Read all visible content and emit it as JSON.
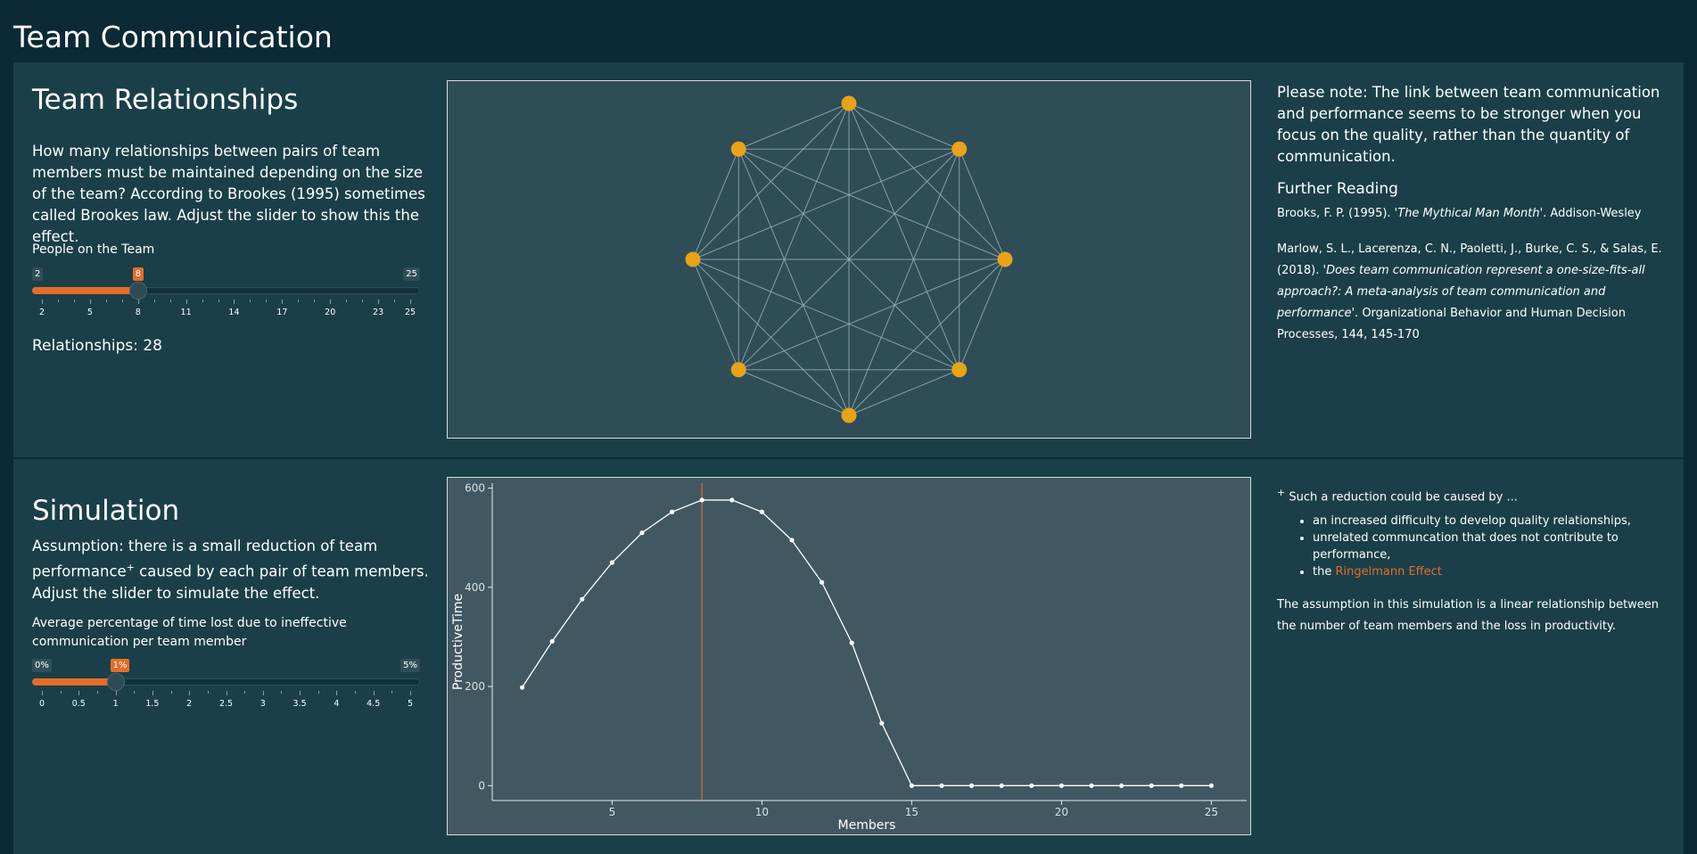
{
  "app_title": "Team Communication",
  "relationships": {
    "title": "Team Relationships",
    "description": "How many relationships between pairs of team members must be maintained depending on the size of the team? According to Brookes (1995) sometimes called Brookes law. Adjust the slider to show this the effect.",
    "slider": {
      "label": "People on the Team",
      "min": 2,
      "max": 25,
      "value": 8,
      "min_label": "2",
      "max_label": "25",
      "value_label": "8",
      "ticks": [
        "2",
        "5",
        "8",
        "11",
        "14",
        "17",
        "20",
        "23",
        "25"
      ],
      "tick_values": [
        2,
        5,
        8,
        11,
        14,
        17,
        20,
        23,
        25
      ]
    },
    "result_text": "Relationships: 28",
    "network": {
      "nodes": 8,
      "node_color": "#e8a317",
      "edge_color": "#a9b8bc"
    }
  },
  "notes": {
    "note": "Please note: The link between team communication and performance seems to be stronger when you focus on the quality, rather than the quantity of communication.",
    "further_reading": "Further Reading",
    "ref1_pre": "Brooks, F. P. (1995). '",
    "ref1_title": "The Mythical Man Month",
    "ref1_post": "'. Addison-Wesley",
    "ref2_pre": "Marlow, S. L., Lacerenza, C. N., Paoletti, J., Burke, C. S., & Salas, E. (2018). '",
    "ref2_title": "Does team communication represent a one-size-fits-all approach?: A meta-analysis of team communication and performance",
    "ref2_post": "'. Organizational Behavior and Human Decision Processes, 144, 145-170"
  },
  "simulation": {
    "title": "Simulation",
    "description_pre": "Assumption: there is a small reduction of team performance",
    "description_mark": "+",
    "description_post": " caused by each pair of team members. Adjust the slider to simulate the effect.",
    "slider": {
      "label": "Average percentage of time lost due to ineffective communication per team member",
      "min": 0,
      "max": 5,
      "value": 1,
      "min_label": "0%",
      "max_label": "5%",
      "value_label": "1%",
      "ticks": [
        "0",
        "0.5",
        "1",
        "1.5",
        "2",
        "2.5",
        "3",
        "3.5",
        "4",
        "4.5",
        "5"
      ],
      "tick_values": [
        0,
        0.5,
        1,
        1.5,
        2,
        2.5,
        3,
        3.5,
        4,
        4.5,
        5
      ]
    }
  },
  "footnote": {
    "mark": "+",
    "intro": "Such a reduction could be caused by ...",
    "items": [
      "an increased difficulty to develop quality relationships,",
      "unrelated communcation that does not contribute to performance,"
    ],
    "item3_pre": "the ",
    "item3_link": "Ringelmann Effect",
    "conclusion": "The assumption in this simulation is a linear relationship between the number of team members and the loss in productivity."
  },
  "chart_data": {
    "type": "line",
    "xlabel": "Members",
    "ylabel": "ProductiveTime",
    "xlim": [
      1,
      26
    ],
    "ylim": [
      -30,
      610
    ],
    "xticks": [
      5,
      10,
      15,
      20,
      25
    ],
    "yticks": [
      0,
      200,
      400,
      600
    ],
    "marker_x": 8,
    "line_color": "#ffffff",
    "marker_color": "#e36d2a",
    "x": [
      2,
      3,
      4,
      5,
      6,
      7,
      8,
      9,
      10,
      11,
      12,
      13,
      14,
      15,
      16,
      17,
      18,
      19,
      20,
      21,
      22,
      23,
      24,
      25
    ],
    "y": [
      198,
      291,
      376,
      450,
      510,
      552,
      576,
      576,
      552,
      495,
      410,
      288,
      126,
      0,
      0,
      0,
      0,
      0,
      0,
      0,
      0,
      0,
      0,
      0
    ]
  }
}
